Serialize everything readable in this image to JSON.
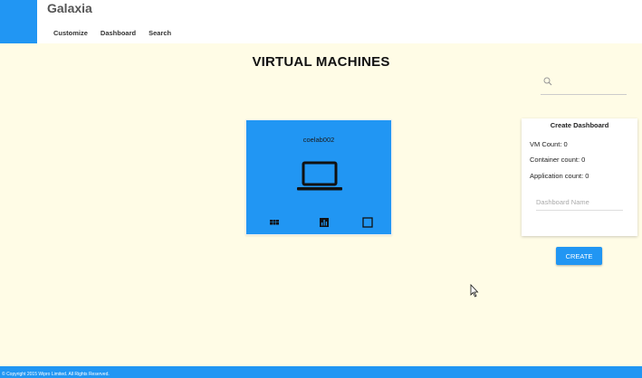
{
  "header": {
    "brand": "Galaxia",
    "nav": [
      "Customize",
      "Dashboard",
      "Search"
    ],
    "brand_color": "#2196f3"
  },
  "main": {
    "title": "VIRTUAL MACHINES",
    "search": {
      "placeholder": "",
      "icon": "search-icon"
    }
  },
  "vm_card": {
    "name": "coelab002",
    "icon": "laptop-icon",
    "actions": [
      "grid-icon",
      "bar-chart-icon",
      "square-icon"
    ]
  },
  "dashboard_panel": {
    "title": "Create Dashboard",
    "vm_count": "VM Count: 0",
    "container_count": "Container count: 0",
    "application_count": "Application count: 0",
    "name_placeholder": "Dashboard Name",
    "create_label": "CREATE"
  },
  "footer": {
    "text": "© Copyright 2015 Wipro Limited. All Rights Reserved."
  },
  "colors": {
    "background": "#fffce6",
    "accent": "#2196f3"
  }
}
